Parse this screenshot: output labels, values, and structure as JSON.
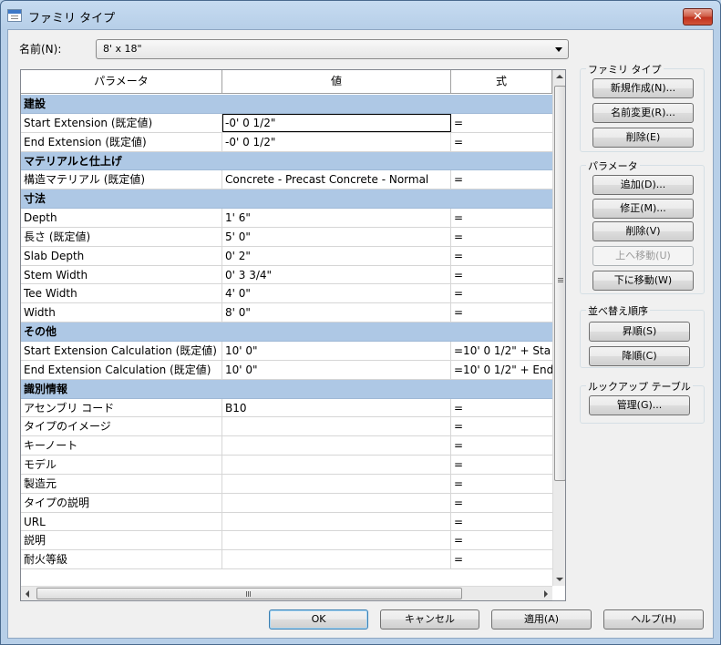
{
  "window": {
    "title": "ファミリ タイプ",
    "close_glyph": "✕"
  },
  "name_field": {
    "label": "名前(N):",
    "value": "8' x 18\""
  },
  "grid": {
    "headers": [
      "パラメータ",
      "値",
      "式"
    ],
    "rows": [
      {
        "type": "group",
        "label": "建設"
      },
      {
        "param": "Start Extension (既定値)",
        "value": "-0'  0 1/2\"",
        "formula": "="
      },
      {
        "param": "End Extension (既定値)",
        "value": "-0'  0 1/2\"",
        "formula": "="
      },
      {
        "type": "group",
        "label": "マテリアルと仕上げ"
      },
      {
        "param": "構造マテリアル (既定値)",
        "value": "Concrete - Precast Concrete - Normal",
        "formula": "="
      },
      {
        "type": "group",
        "label": "寸法"
      },
      {
        "param": "Depth",
        "value": "1'  6\"",
        "formula": "="
      },
      {
        "param": "長さ (既定値)",
        "value": "5'  0\"",
        "formula": "="
      },
      {
        "param": "Slab Depth",
        "value": "0'  2\"",
        "formula": "="
      },
      {
        "param": "Stem Width",
        "value": "0'  3 3/4\"",
        "formula": "="
      },
      {
        "param": "Tee Width",
        "value": "4'  0\"",
        "formula": "="
      },
      {
        "param": "Width",
        "value": "8'  0\"",
        "formula": "="
      },
      {
        "type": "group",
        "label": "その他"
      },
      {
        "param": "Start Extension Calculation (既定値)",
        "value": "10'  0\"",
        "formula": "=10'  0 1/2\" + Sta"
      },
      {
        "param": "End Extension Calculation (既定値)",
        "value": "10'  0\"",
        "formula": "=10'  0 1/2\" + End"
      },
      {
        "type": "group",
        "label": "識別情報"
      },
      {
        "param": "アセンブリ コード",
        "value": "B10",
        "formula": "="
      },
      {
        "param": "タイプのイメージ",
        "value": "",
        "formula": "="
      },
      {
        "param": "キーノート",
        "value": "",
        "formula": "="
      },
      {
        "param": "モデル",
        "value": "",
        "formula": "="
      },
      {
        "param": "製造元",
        "value": "",
        "formula": "="
      },
      {
        "param": "タイプの説明",
        "value": "",
        "formula": "="
      },
      {
        "param": "URL",
        "value": "",
        "formula": "="
      },
      {
        "param": "説明",
        "value": "",
        "formula": "="
      },
      {
        "param": "耐火等級",
        "value": "",
        "formula": "="
      }
    ]
  },
  "family_types_group": {
    "label": "ファミリ タイプ",
    "new_button": "新規作成(N)...",
    "rename_button": "名前変更(R)...",
    "delete_button": "削除(E)"
  },
  "parameters_group": {
    "label": "パラメータ",
    "add_button": "追加(D)...",
    "modify_button": "修正(M)...",
    "remove_button": "削除(V)",
    "move_up_button": "上へ移動(U)",
    "move_down_button": "下に移動(W)"
  },
  "sort_group": {
    "label": "並べ替え順序",
    "ascending_button": "昇順(S)",
    "descending_button": "降順(C)"
  },
  "lookup_group": {
    "label": "ルックアップ テーブル",
    "manage_button": "管理(G)..."
  },
  "footer": {
    "ok": "OK",
    "cancel": "キャンセル",
    "apply": "適用(A)",
    "help": "ヘルプ(H)"
  },
  "scrollbar_grip": "≡"
}
